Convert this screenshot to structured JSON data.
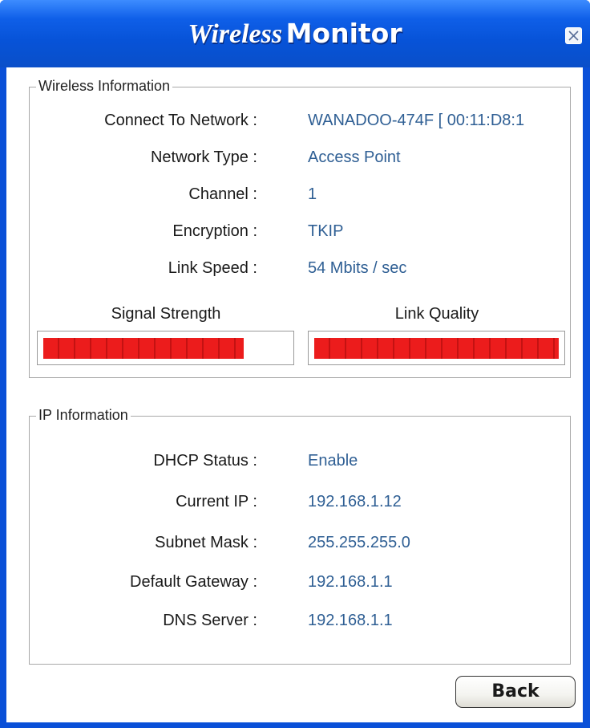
{
  "window": {
    "title_styled": "Wireless",
    "title_bold": "Monitor"
  },
  "wireless_info": {
    "legend": "Wireless Information",
    "rows": [
      {
        "label": "Connect To Network :",
        "value": "WANADOO-474F [ 00:11:D8:1"
      },
      {
        "label": "Network Type :",
        "value": "Access Point"
      },
      {
        "label": "Channel :",
        "value": "1"
      },
      {
        "label": "Encryption :",
        "value": "TKIP"
      },
      {
        "label": "Link Speed :",
        "value": "54 Mbits / sec"
      }
    ],
    "signal_strength": {
      "label": "Signal Strength",
      "level": 0.82
    },
    "link_quality": {
      "label": "Link Quality",
      "level": 1.0
    },
    "meter_color": "#ec1c1c"
  },
  "ip_info": {
    "legend": "IP Information",
    "rows": [
      {
        "label": "DHCP Status :",
        "value": "Enable"
      },
      {
        "label": "Current IP :",
        "value": "192.168.1.12"
      },
      {
        "label": "Subnet Mask :",
        "value": "255.255.255.0"
      },
      {
        "label": "Default Gateway :",
        "value": "192.168.1.1"
      },
      {
        "label": "DNS Server :",
        "value": "192.168.1.1"
      }
    ]
  },
  "buttons": {
    "back": "Back"
  },
  "colors": {
    "titlebar": "#0753d8",
    "value_text": "#2f5f94"
  },
  "icons": {
    "close": "close-icon"
  }
}
